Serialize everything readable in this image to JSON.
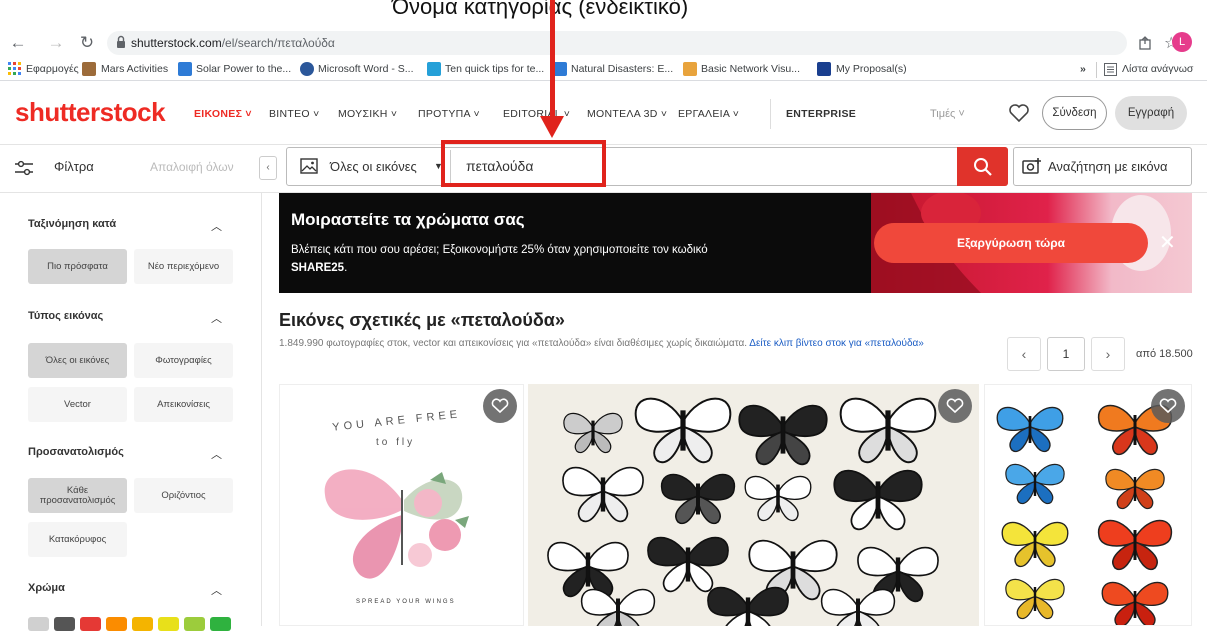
{
  "caption": "Όνομα κατηγορίας (ενδεικτικό)",
  "browser": {
    "url_domain": "shutterstock.com",
    "url_path": "/el/search/πεταλούδα",
    "avatar_letter": "L",
    "bookmarks": [
      {
        "label": "Εφαρμογές",
        "color": "#4285f4"
      },
      {
        "label": "Mars Activities",
        "color": "#9c6b3a"
      },
      {
        "label": "Solar Power to the...",
        "color": "#2e7bd6"
      },
      {
        "label": "Microsoft Word - S...",
        "color": "#2b579a"
      },
      {
        "label": "Ten quick tips for te...",
        "color": "#25a0d8"
      },
      {
        "label": "Natural Disasters: E...",
        "color": "#2e7bd6"
      },
      {
        "label": "Basic Network Visu...",
        "color": "#e8a33c"
      },
      {
        "label": "My Proposal(s)",
        "color": "#1a3f8f"
      }
    ],
    "overflow": "»",
    "reading_list": "Λίστα ανάγνωσ"
  },
  "header": {
    "logo": "shutterstock",
    "nav": [
      {
        "label": "ΕΙΚΟΝΕΣ",
        "active": true
      },
      {
        "label": "ΒΙΝΤΕΟ"
      },
      {
        "label": "ΜΟΥΣΙΚΗ"
      },
      {
        "label": "ΠΡΟΤΥΠΑ"
      },
      {
        "label": "EDITORIAL"
      },
      {
        "label": "ΜΟΝΤΕΛΑ 3D"
      },
      {
        "label": "ΕΡΓΑΛΕΙΑ"
      }
    ],
    "enterprise": "ENTERPRISE",
    "prices": "Τιμές",
    "login": "Σύνδεση",
    "signup": "Εγγραφή"
  },
  "search": {
    "filters": "Φίλτρα",
    "clear_all": "Απαλοιφή όλων",
    "collapse": "‹",
    "image_type": "Όλες οι εικόνες",
    "query": "πεταλούδα",
    "image_search": "Αναζήτηση με εικόνα"
  },
  "sidebar": {
    "sort": {
      "title": "Ταξινόμηση κατά",
      "options": [
        "Πιο πρόσφατα",
        "Νέο περιεχόμενο"
      ],
      "selected": 0
    },
    "image_type": {
      "title": "Τύπος εικόνας",
      "options": [
        "Όλες οι εικόνες",
        "Φωτογραφίες",
        "Vector",
        "Απεικονίσεις"
      ],
      "selected": 0
    },
    "orientation": {
      "title": "Προσανατολισμός",
      "options": [
        "Κάθε προσανατολισμός",
        "Οριζόντιος",
        "Κατακόρυφος"
      ],
      "selected": 0
    },
    "color": {
      "title": "Χρώμα",
      "swatches": [
        "#d0d0d0",
        "#555555",
        "#e53935",
        "#fb8c00",
        "#f4b400",
        "#e8e01a",
        "#9ccc3c",
        "#2fb23f"
      ]
    }
  },
  "banner": {
    "title": "Μοιραστείτε τα χρώματα σας",
    "text": "Βλέπεις κάτι που σου αρέσει; Εξοικονομήστε 25% όταν χρησιμοποιείτε τον κωδικό",
    "code": "SHARE25",
    "cta": "Εξαργύρωση τώρα",
    "close": "✕"
  },
  "results": {
    "title": "Εικόνες σχετικές με «πεταλούδα»",
    "desc": "1.849.990 φωτογραφίες στοκ, vector και απεικονίσεις για «πεταλούδα» είναι διαθέσιμες χωρίς δικαιώματα.",
    "link": "Δείτε κλιπ βίντεο στοκ για «πεταλούδα»",
    "page": "1",
    "total": "από 18.500",
    "tile1_text_top": "YOU ARE FREE",
    "tile1_text_mid": "to fly",
    "tile1_text_bottom": "SPREAD YOUR WINGS"
  }
}
